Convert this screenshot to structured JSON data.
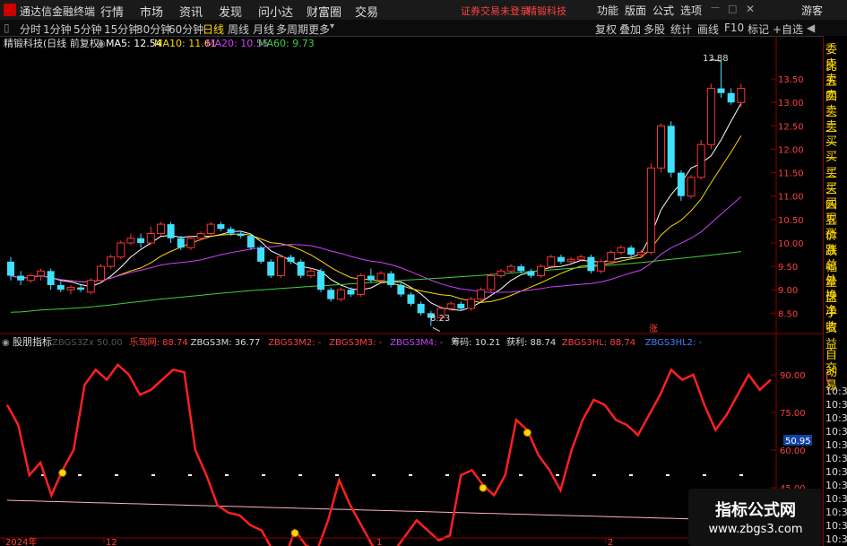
{
  "app": {
    "title": "通达信金融终端"
  },
  "menu": [
    "行情",
    "市场",
    "资讯",
    "发现",
    "问小达",
    "财富圈",
    "交易"
  ],
  "status": {
    "warning": "证券交易未登录",
    "stock": "精锻科技"
  },
  "right_menu": [
    "功能",
    "版面",
    "公式",
    "选项",
    "游客"
  ],
  "toolbar": {
    "periods": [
      "分时",
      "1分钟",
      "5分钟",
      "15分钟",
      "30分钟",
      "60分钟",
      "日线",
      "周线",
      "月线",
      "多周期",
      "更多"
    ],
    "active_period": "日线",
    "right": [
      "复权",
      "叠加",
      "多股",
      "统计",
      "画线",
      "F10",
      "标记",
      "+自选"
    ]
  },
  "main_chart": {
    "title": "精锻科技(日线 前复权)",
    "ma": [
      {
        "label": "MA5: 12.54",
        "color": "#ffffff"
      },
      {
        "label": "MA10: 11.61",
        "color": "#ffd700"
      },
      {
        "label": "MA20: 10.55",
        "color": "#d040ff"
      },
      {
        "label": "MA60: 9.73",
        "color": "#40d040"
      }
    ],
    "high_label": "13.88",
    "low_label": "8.23",
    "zhang_mark": "涨",
    "y_ticks": [
      "13.50",
      "13.00",
      "12.50",
      "12.00",
      "11.50",
      "11.00",
      "10.50",
      "10.00",
      "9.50",
      "9.00",
      "8.50"
    ]
  },
  "chart_data": [
    {
      "type": "candlestick",
      "title": "精锻科技(日线 前复权)",
      "ylim": [
        8.2,
        14.0
      ],
      "candles": [
        [
          9.6,
          9.3,
          9.7,
          9.2
        ],
        [
          9.3,
          9.2,
          9.4,
          9.1
        ],
        [
          9.2,
          9.3,
          9.35,
          9.15
        ],
        [
          9.3,
          9.4,
          9.45,
          9.2
        ],
        [
          9.4,
          9.1,
          9.45,
          9.0
        ],
        [
          9.1,
          9.0,
          9.2,
          8.95
        ],
        [
          9.0,
          9.05,
          9.1,
          8.9
        ],
        [
          9.05,
          9.0,
          9.1,
          8.95
        ],
        [
          8.95,
          9.2,
          9.25,
          8.9
        ],
        [
          9.2,
          9.5,
          9.55,
          9.15
        ],
        [
          9.5,
          9.7,
          9.75,
          9.45
        ],
        [
          9.7,
          10.0,
          10.05,
          9.65
        ],
        [
          10.0,
          10.1,
          10.2,
          9.95
        ],
        [
          10.1,
          10.0,
          10.2,
          9.9
        ],
        [
          10.0,
          10.2,
          10.35,
          9.95
        ],
        [
          10.2,
          10.4,
          10.45,
          10.15
        ],
        [
          10.4,
          10.1,
          10.45,
          10.0
        ],
        [
          10.1,
          9.9,
          10.15,
          9.85
        ],
        [
          9.9,
          10.1,
          10.15,
          9.85
        ],
        [
          10.1,
          10.2,
          10.25,
          10.05
        ],
        [
          10.2,
          10.4,
          10.45,
          10.15
        ],
        [
          10.4,
          10.3,
          10.45,
          10.25
        ],
        [
          10.3,
          10.2,
          10.35,
          10.15
        ],
        [
          10.2,
          10.15,
          10.25,
          10.1
        ],
        [
          10.15,
          9.9,
          10.2,
          9.85
        ],
        [
          9.9,
          9.6,
          9.95,
          9.55
        ],
        [
          9.6,
          9.3,
          9.65,
          9.25
        ],
        [
          9.3,
          9.7,
          9.75,
          9.25
        ],
        [
          9.7,
          9.6,
          9.75,
          9.55
        ],
        [
          9.6,
          9.3,
          9.65,
          9.25
        ],
        [
          9.3,
          9.4,
          9.45,
          9.25
        ],
        [
          9.4,
          9.0,
          9.45,
          8.95
        ],
        [
          9.0,
          8.8,
          9.05,
          8.75
        ],
        [
          8.8,
          9.0,
          9.05,
          8.75
        ],
        [
          9.0,
          8.9,
          9.05,
          8.85
        ],
        [
          8.9,
          9.3,
          9.35,
          8.85
        ],
        [
          9.3,
          9.2,
          9.45,
          9.15
        ],
        [
          9.2,
          9.35,
          9.4,
          9.15
        ],
        [
          9.35,
          9.1,
          9.4,
          9.05
        ],
        [
          9.1,
          8.9,
          9.15,
          8.85
        ],
        [
          8.9,
          8.7,
          8.95,
          8.65
        ],
        [
          8.7,
          8.5,
          8.75,
          8.45
        ],
        [
          8.5,
          8.4,
          8.55,
          8.23
        ],
        [
          8.4,
          8.6,
          8.65,
          8.35
        ],
        [
          8.6,
          8.7,
          8.75,
          8.55
        ],
        [
          8.7,
          8.6,
          8.75,
          8.55
        ],
        [
          8.6,
          8.8,
          8.85,
          8.55
        ],
        [
          8.8,
          9.0,
          9.05,
          8.75
        ],
        [
          9.0,
          9.3,
          9.35,
          8.95
        ],
        [
          9.3,
          9.4,
          9.45,
          9.25
        ],
        [
          9.4,
          9.5,
          9.55,
          9.35
        ],
        [
          9.5,
          9.4,
          9.55,
          9.35
        ],
        [
          9.4,
          9.3,
          9.45,
          9.25
        ],
        [
          9.3,
          9.5,
          9.55,
          9.25
        ],
        [
          9.5,
          9.7,
          9.75,
          9.45
        ],
        [
          9.7,
          9.6,
          9.75,
          9.55
        ],
        [
          9.6,
          9.65,
          9.7,
          9.55
        ],
        [
          9.65,
          9.7,
          9.75,
          9.6
        ],
        [
          9.7,
          9.4,
          9.75,
          9.35
        ],
        [
          9.4,
          9.6,
          9.65,
          9.35
        ],
        [
          9.6,
          9.8,
          9.85,
          9.55
        ],
        [
          9.8,
          9.9,
          9.95,
          9.75
        ],
        [
          9.9,
          9.75,
          9.95,
          9.7
        ],
        [
          9.75,
          9.8,
          9.85,
          9.7
        ],
        [
          9.8,
          11.6,
          11.7,
          9.75
        ],
        [
          11.6,
          12.5,
          12.55,
          11.5
        ],
        [
          12.5,
          11.5,
          12.6,
          11.4
        ],
        [
          11.5,
          11.0,
          11.55,
          10.9
        ],
        [
          11.0,
          11.4,
          11.45,
          10.95
        ],
        [
          11.4,
          12.1,
          12.2,
          11.35
        ],
        [
          12.1,
          13.3,
          13.4,
          12.0
        ],
        [
          13.3,
          13.2,
          13.88,
          13.1
        ],
        [
          13.2,
          13.0,
          13.3,
          12.95
        ],
        [
          13.0,
          13.3,
          13.4,
          12.9
        ]
      ]
    },
    {
      "type": "line",
      "title": "股朋指标",
      "ylim": [
        25,
        100
      ],
      "series": [
        {
          "name": "乐驾网",
          "values": [
            78,
            70,
            50,
            55,
            42,
            52,
            60,
            86,
            92,
            88,
            94,
            90,
            82,
            84,
            88,
            92,
            91,
            60,
            50,
            38,
            35,
            34,
            30,
            28,
            20,
            16,
            28,
            22,
            20,
            32,
            48,
            38,
            30,
            22,
            18,
            20,
            26,
            32,
            28,
            24,
            26,
            50,
            52,
            46,
            42,
            50,
            72,
            68,
            58,
            52,
            44,
            60,
            72,
            80,
            78,
            72,
            70,
            66,
            74,
            82,
            92,
            88,
            90,
            78,
            68,
            74,
            82,
            90,
            84,
            88
          ]
        },
        {
          "name": "ZBGS3HL",
          "values": [
            50.95
          ]
        }
      ]
    }
  ],
  "indicator": {
    "title": "股朋指标",
    "items": [
      {
        "label": "ZBGS3Zx 50.00",
        "color": "#555555"
      },
      {
        "label": "乐驾网: 88.74",
        "color": "#ff4040"
      },
      {
        "label": "ZBGS3M: 36.77",
        "color": "#dddddd"
      },
      {
        "label": "ZBGS3M2: -",
        "color": "#ff4040"
      },
      {
        "label": "ZBGS3M3: -",
        "color": "#ff4040"
      },
      {
        "label": "ZBGS3M4: -",
        "color": "#d040ff"
      },
      {
        "label": "筹码: 10.21",
        "color": "#dddddd"
      },
      {
        "label": "获利: 88.74",
        "color": "#dddddd"
      },
      {
        "label": "ZBGS3HL: 88.74",
        "color": "#ff4040"
      },
      {
        "label": "ZBGS3HL2: -",
        "color": "#4080ff"
      }
    ],
    "y_ticks": [
      "90.00",
      "75.00",
      "60.00",
      "45.00",
      "30.00"
    ],
    "current_value": "50.95"
  },
  "side_panel": {
    "top_items": [
      "委比",
      "卖五",
      "卖四",
      "卖三",
      "卖二",
      "卖一",
      "买一",
      "买二",
      "买三",
      "买四",
      "买五",
      "现价",
      "涨跌",
      "涨幅",
      "总量",
      "外盘",
      "换手",
      "净资",
      "收益"
    ],
    "bottom_items": [
      "自动",
      "交易",
      "L",
      "10:33",
      "10:33",
      "10:33",
      "10:33",
      "10:33",
      "10:33",
      "10:33",
      "10:33",
      "10:33",
      "10:33",
      "10:33",
      "10:33"
    ]
  },
  "time_axis": [
    "2024年",
    "12",
    "1",
    "2"
  ],
  "watermark": {
    "title": "指标公式网",
    "url": "www.zbgs3.com"
  }
}
